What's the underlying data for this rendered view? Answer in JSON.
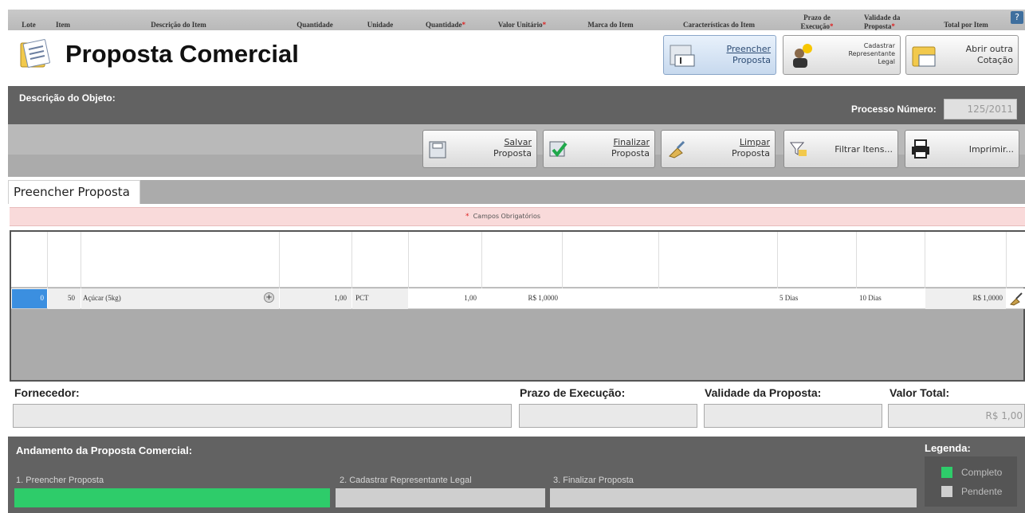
{
  "header": {
    "title": "Proposta Comercial",
    "help_icon": "?",
    "buttons": [
      {
        "line1": "Preencher",
        "line2": "Proposta"
      },
      {
        "line1": "Cadastrar",
        "line2": "Representante",
        "line3": "Legal"
      },
      {
        "line1": "Abrir outra",
        "line2": "Cotação"
      }
    ]
  },
  "object": {
    "label": "Descrição do Objeto:",
    "processo_label": "Processo Número:",
    "processo_value": "125/2011"
  },
  "toolbar": {
    "salvar": {
      "line1": "Salvar",
      "line2": "Proposta"
    },
    "finalizar": {
      "line1": "Finalizar",
      "line2": "Proposta"
    },
    "limpar": {
      "line1": "Limpar",
      "line2": "Proposta"
    },
    "filtrar": "Filtrar Itens...",
    "imprimir": "Imprimir..."
  },
  "tab": {
    "label": "Preencher Proposta"
  },
  "required_note": "Campos Obrigatórios",
  "required_star": "*",
  "grid": {
    "columns": {
      "lote": "Lote",
      "item": "Item",
      "descricao": "Descrição do Item",
      "quantidade": "Quantidade",
      "unidade": "Unidade",
      "quantidade2": "Quantidade",
      "valor_unitario": "Valor Unitário",
      "marca": "Marca do Item",
      "caracteristicas": "Características do Item",
      "prazo_l1": "Prazo de",
      "prazo_l2": "Execução",
      "validade_l1": "Validade da",
      "validade_l2": "Proposta",
      "total": "Total por Item"
    },
    "row": {
      "lote": "0",
      "item": "50",
      "descricao": "Açúcar (5kg)",
      "quantidade": "1,00",
      "unidade": "PCT",
      "quantidade2": "1,00",
      "valor_unitario": "R$ 1,0000",
      "marca": "",
      "caracteristicas": "",
      "prazo": "5 Dias",
      "validade": "10 Dias",
      "total": "R$ 1,0000"
    }
  },
  "summary": {
    "fornecedor_label": "Fornecedor:",
    "prazo_label": "Prazo de Execução:",
    "validade_label": "Validade da Proposta:",
    "valor_total_label": "Valor Total:",
    "valor_total_value": "R$ 1,00"
  },
  "progress": {
    "title": "Andamento da Proposta Comercial:",
    "steps": [
      {
        "label": "1. Preencher Proposta",
        "status": "complete"
      },
      {
        "label": "2. Cadastrar Representante Legal",
        "status": "pending"
      },
      {
        "label": "3. Finalizar Proposta",
        "status": "pending"
      }
    ],
    "legend_title": "Legenda:",
    "legend_complete": "Completo",
    "legend_pending": "Pendente"
  },
  "colors": {
    "complete": "#2ecc6a",
    "pending": "#cfcfcf",
    "selected_cell": "#3b8fe0",
    "required_bg": "#f9dada"
  }
}
